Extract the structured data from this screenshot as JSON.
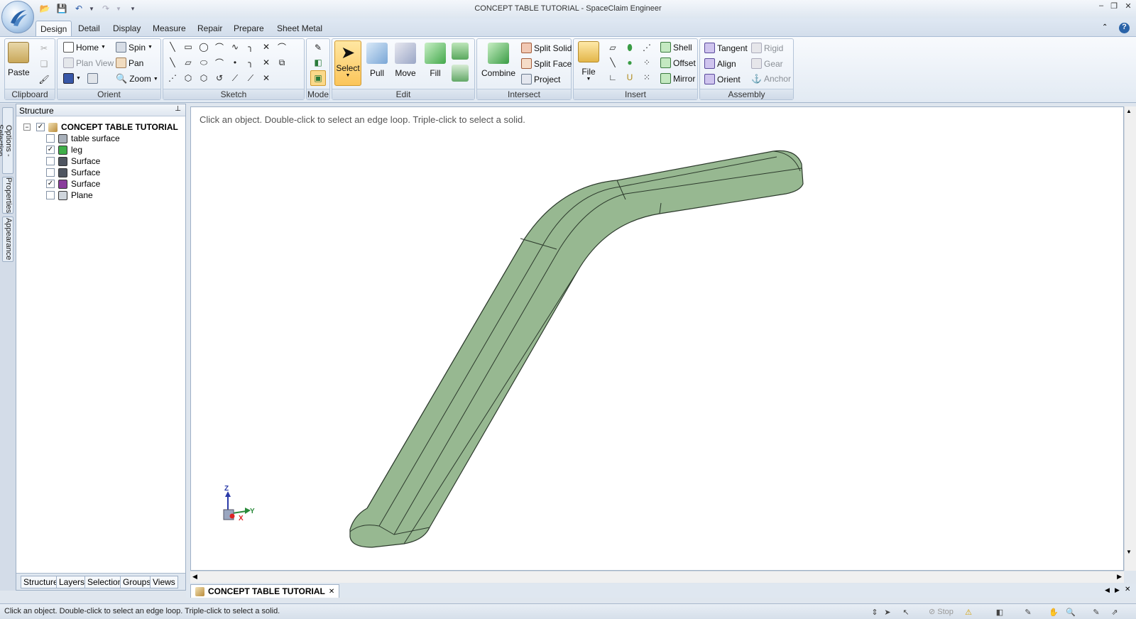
{
  "app": {
    "title": "CONCEPT TABLE TUTORIAL - SpaceClaim Engineer"
  },
  "ribbon_tabs": [
    "Design",
    "Detail",
    "Display",
    "Measure",
    "Repair",
    "Prepare",
    "Sheet Metal"
  ],
  "active_tab": "Design",
  "clipboard": {
    "paste": "Paste",
    "label": "Clipboard"
  },
  "orient": {
    "home": "Home",
    "spin": "Spin",
    "plan_view": "Plan View",
    "pan": "Pan",
    "zoom": "Zoom",
    "label": "Orient"
  },
  "sketch": {
    "label": "Sketch"
  },
  "mode": {
    "label": "Mode"
  },
  "edit": {
    "select": "Select",
    "pull": "Pull",
    "move": "Move",
    "fill": "Fill",
    "label": "Edit"
  },
  "intersect": {
    "combine": "Combine",
    "split_solid": "Split Solid",
    "split_face": "Split Face",
    "project": "Project",
    "label": "Intersect"
  },
  "insert": {
    "file": "File",
    "shell": "Shell",
    "offset": "Offset",
    "mirror": "Mirror",
    "label": "Insert"
  },
  "assembly": {
    "tangent": "Tangent",
    "align": "Align",
    "orient": "Orient",
    "rigid": "Rigid",
    "gear": "Gear",
    "anchor": "Anchor",
    "label": "Assembly"
  },
  "side_tabs": {
    "options": "Options - Selection",
    "properties": "Properties",
    "appearance": "Appearance"
  },
  "structure": {
    "title": "Structure",
    "root": "CONCEPT TABLE TUTORIAL",
    "items": [
      {
        "label": "table surface",
        "checked": false,
        "icon": "solid-icon",
        "color": "#a8b0ba"
      },
      {
        "label": "leg",
        "checked": true,
        "icon": "solid-icon",
        "color": "#3fae49"
      },
      {
        "label": "Surface",
        "checked": false,
        "icon": "surface-icon",
        "color": "#4f5560"
      },
      {
        "label": "Surface",
        "checked": false,
        "icon": "surface-icon",
        "color": "#4f5560"
      },
      {
        "label": "Surface",
        "checked": true,
        "icon": "surface-icon",
        "color": "#8a3c9c"
      },
      {
        "label": "Plane",
        "checked": false,
        "icon": "plane-icon",
        "color": "#cfd5dc"
      }
    ],
    "bottom_tabs": [
      "Structure",
      "Layers",
      "Selection",
      "Groups",
      "Views"
    ]
  },
  "viewport": {
    "hint": "Click an object. Double-click to select an edge loop. Triple-click to select a solid.",
    "axes": {
      "z": "Z",
      "y": "Y",
      "x": "X"
    },
    "model_color": "#97b891"
  },
  "document_tab": "CONCEPT TABLE TUTORIAL",
  "status": {
    "text": "Click an object. Double-click to select an edge loop. Triple-click to select a solid.",
    "stop": "Stop"
  }
}
